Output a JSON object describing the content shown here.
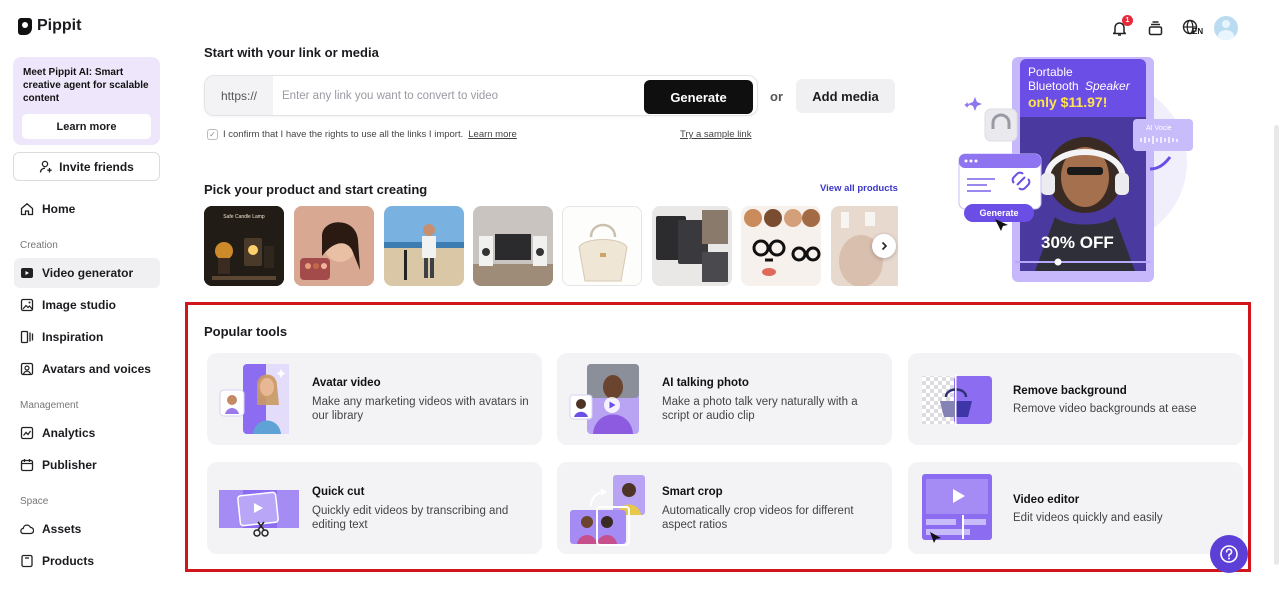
{
  "app": {
    "name": "Pippit"
  },
  "sidebar": {
    "promo": {
      "text": "Meet Pippit AI: Smart creative agent for scalable content",
      "button": "Learn more"
    },
    "invite_label": "Invite friends",
    "home_label": "Home",
    "sections": {
      "creation": "Creation",
      "management": "Management",
      "space": "Space"
    },
    "items": {
      "video_generator": "Video generator",
      "image_studio": "Image studio",
      "inspiration": "Inspiration",
      "avatars_voices": "Avatars and voices",
      "analytics": "Analytics",
      "publisher": "Publisher",
      "assets": "Assets",
      "products": "Products"
    }
  },
  "header": {
    "notification_count": "1",
    "language": "EN"
  },
  "link_section": {
    "title": "Start with your link or media",
    "prefix": "https://",
    "placeholder": "Enter any link you want to convert to video",
    "generate_label": "Generate",
    "or_label": "or",
    "add_media_label": "Add media",
    "confirm_text": "I confirm that I have the rights to use all the links I import.",
    "learn_more": "Learn more",
    "sample_link": "Try a sample link"
  },
  "products_section": {
    "title": "Pick your product and start creating",
    "view_all": "View all products",
    "first_thumb_caption": "Safe Candle Lamp"
  },
  "hero": {
    "product_line1": "Portable",
    "product_line2": "Bluetooth",
    "product_line2_em": "Speaker",
    "price": "only $11.97!",
    "discount": "30% OFF",
    "ai_voice": "AI Vocie",
    "generate": "Generate"
  },
  "popular_tools": {
    "title": "Popular tools",
    "tools": [
      {
        "name": "Avatar video",
        "desc": "Make any marketing videos with avatars in our library"
      },
      {
        "name": "AI talking photo",
        "desc": "Make a photo talk very naturally with a script or audio clip"
      },
      {
        "name": "Remove background",
        "desc": "Remove video backgrounds at ease"
      },
      {
        "name": "Quick cut",
        "desc": "Quickly edit videos by transcribing and editing text"
      },
      {
        "name": "Smart crop",
        "desc": "Automatically crop videos for different aspect ratios"
      },
      {
        "name": "Video editor",
        "desc": "Edit videos quickly and easily"
      }
    ]
  },
  "colors": {
    "accent_purple": "#6c4ee6",
    "highlight_red": "#d0161b",
    "price_yellow": "#ffe44d",
    "link_blue": "#3b37c9"
  }
}
